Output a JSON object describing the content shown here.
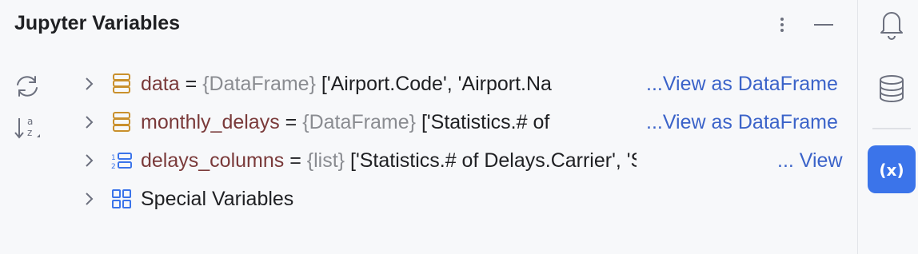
{
  "panel": {
    "title": "Jupyter Variables",
    "header_actions": [
      "more-icon",
      "minimize-icon"
    ],
    "side_actions": [
      "refresh-icon",
      "sort-alpha-icon"
    ]
  },
  "variables": [
    {
      "name": "data",
      "eq": "=",
      "type": "{DataFrame}",
      "value": "['Airport.Code', 'Airport.Na",
      "link": "...View as DataFrame",
      "icon": "dataframe-icon"
    },
    {
      "name": "monthly_delays",
      "eq": "=",
      "type": "{DataFrame}",
      "value": "['Statistics.# of",
      "link": "...View as DataFrame",
      "icon": "dataframe-icon"
    },
    {
      "name": "delays_columns",
      "eq": "=",
      "type": "{list}",
      "value": "['Statistics.# of Delays.Carrier', 'Stati",
      "link": "... View",
      "icon": "list-icon"
    },
    {
      "name": "Special Variables",
      "icon": "special-variables-icon"
    }
  ],
  "rightbar": {
    "items": [
      "notifications-icon",
      "database-icon",
      "variables-icon"
    ],
    "active": "variables-icon",
    "variables_label": "(x)"
  },
  "colors": {
    "accent": "#3b74ea",
    "link": "#3b63c9",
    "var_name": "#7a3a3a",
    "type": "#8a8c91"
  }
}
